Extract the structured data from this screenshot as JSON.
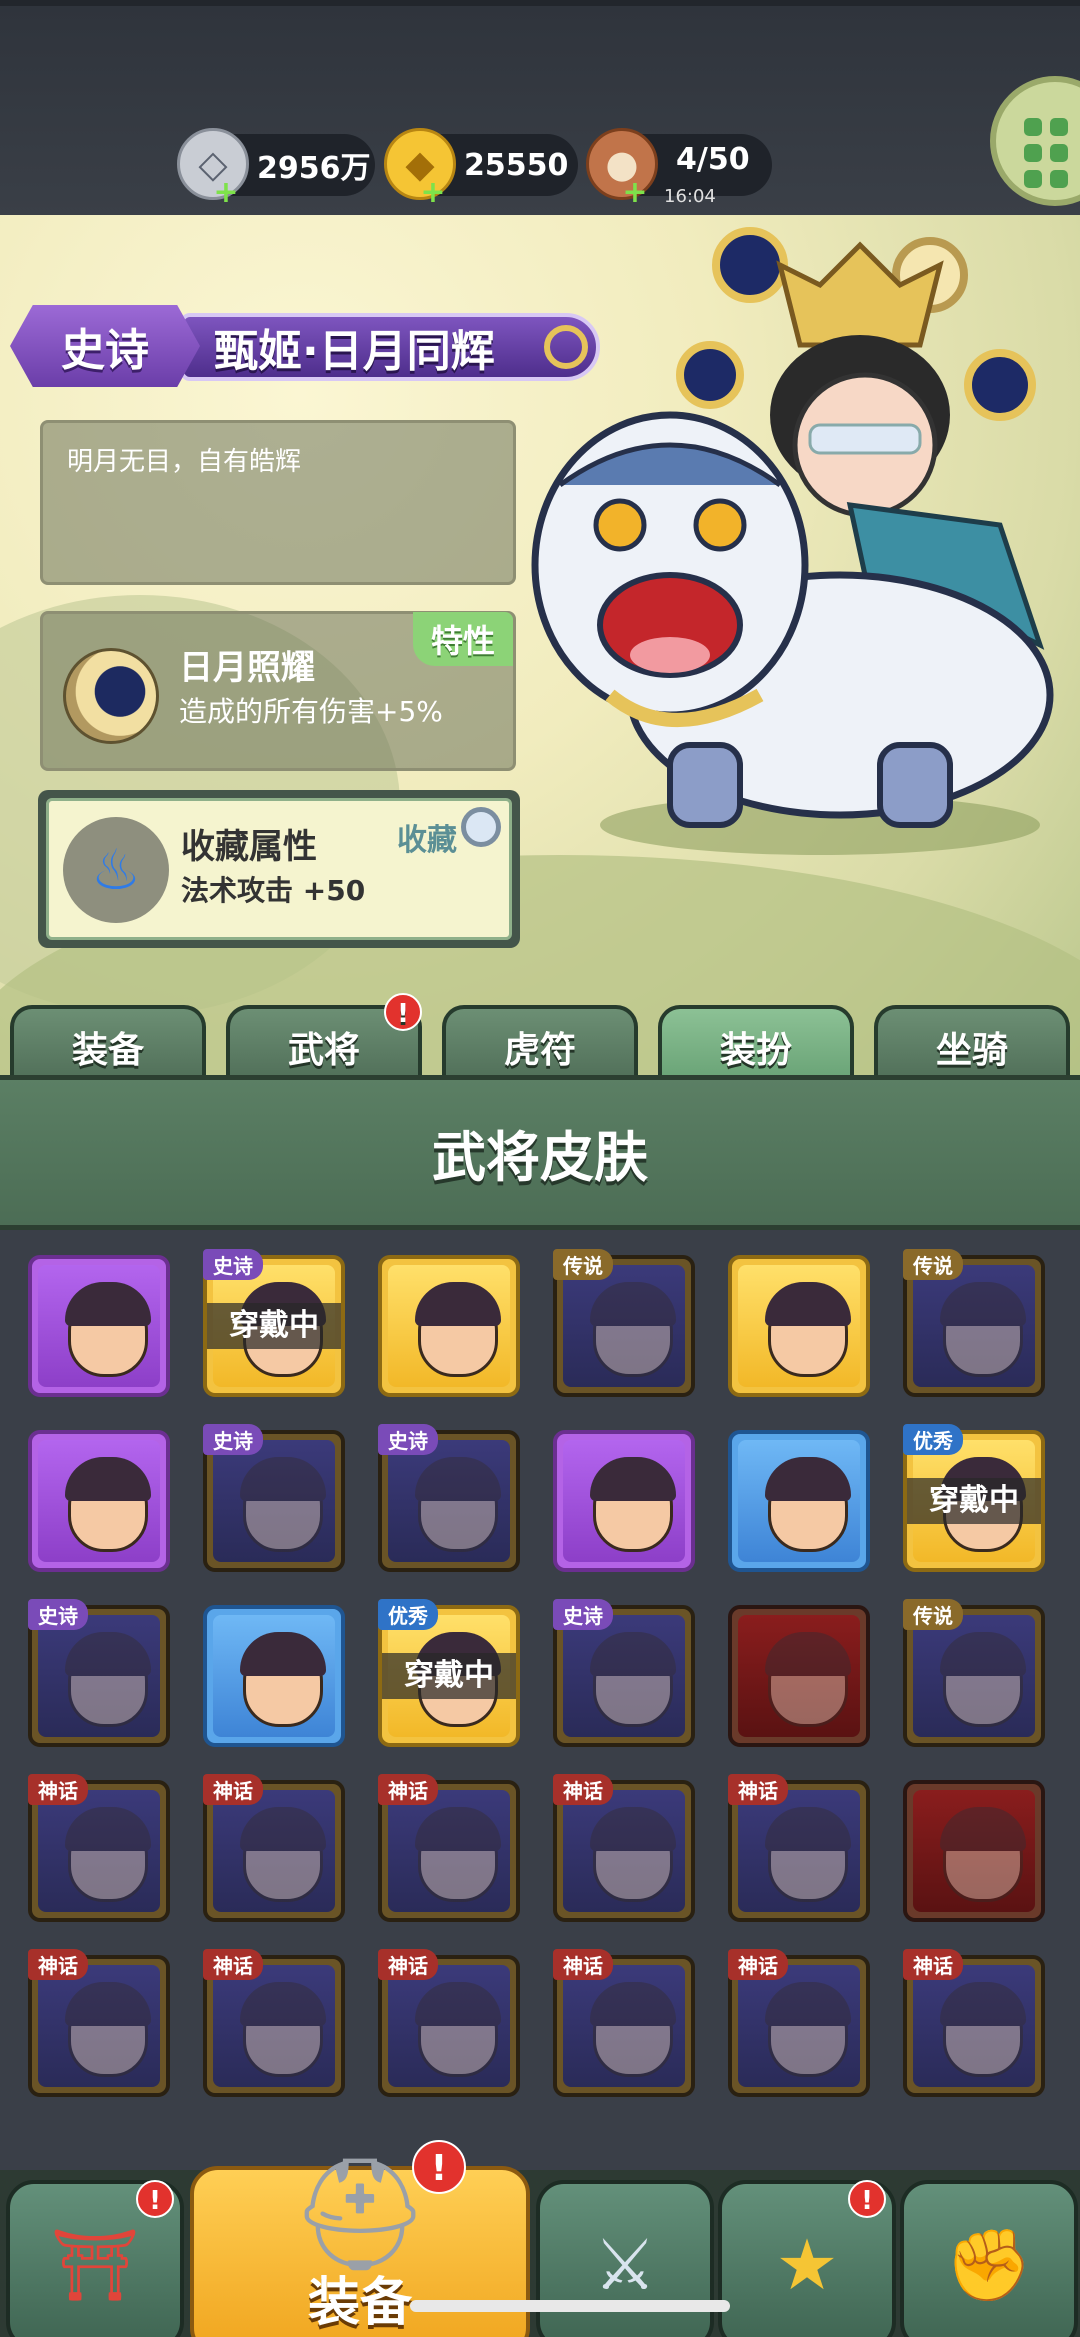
{
  "resources": [
    {
      "icon": "silver-coin-icon",
      "value": "2956万"
    },
    {
      "icon": "gold-ingot-icon",
      "value": "25550"
    },
    {
      "icon": "meat-stamina-icon",
      "value": "4/50",
      "timer": "16:04"
    }
  ],
  "skin": {
    "rarity": "史诗",
    "name": "甄姬·日月同辉",
    "description": "明月无目，自有皓辉",
    "trait": {
      "badge": "特性",
      "name": "日月照耀",
      "effect": "造成的所有伤害+5%"
    },
    "collection": {
      "title": "收藏属性",
      "effect": "法术攻击 +50",
      "tag": "收藏"
    }
  },
  "tabs": [
    {
      "label": "装备",
      "active": false,
      "alert": false
    },
    {
      "label": "武将",
      "active": false,
      "alert": true
    },
    {
      "label": "虎符",
      "active": false,
      "alert": false
    },
    {
      "label": "装扮",
      "active": true,
      "alert": false
    },
    {
      "label": "坐骑",
      "active": false,
      "alert": false
    }
  ],
  "section_title": "武将皮肤",
  "alert_glyph": "!",
  "wearing_label": "穿戴中",
  "skins": [
    {
      "style": "purple",
      "tag": "",
      "wearing": false
    },
    {
      "style": "gold",
      "tag": "史诗",
      "wearing": true
    },
    {
      "style": "gold",
      "tag": "",
      "wearing": false
    },
    {
      "style": "locked",
      "tag": "传说",
      "wearing": false
    },
    {
      "style": "gold",
      "tag": "",
      "wearing": false
    },
    {
      "style": "locked",
      "tag": "传说",
      "wearing": false
    },
    {
      "style": "purple",
      "tag": "",
      "wearing": false
    },
    {
      "style": "locked",
      "tag": "史诗",
      "wearing": false
    },
    {
      "style": "locked",
      "tag": "史诗",
      "wearing": false
    },
    {
      "style": "purple",
      "tag": "",
      "wearing": false
    },
    {
      "style": "blue",
      "tag": "",
      "wearing": false
    },
    {
      "style": "gold",
      "tag": "优秀",
      "wearing": true
    },
    {
      "style": "locked",
      "tag": "史诗",
      "wearing": false
    },
    {
      "style": "blue",
      "tag": "",
      "wearing": false
    },
    {
      "style": "gold",
      "tag": "优秀",
      "wearing": true
    },
    {
      "style": "locked",
      "tag": "史诗",
      "wearing": false
    },
    {
      "style": "red",
      "tag": "",
      "wearing": false
    },
    {
      "style": "locked",
      "tag": "传说",
      "wearing": false
    },
    {
      "style": "locked",
      "tag": "神话",
      "wearing": false
    },
    {
      "style": "locked",
      "tag": "神话",
      "wearing": false
    },
    {
      "style": "locked",
      "tag": "神话",
      "wearing": false
    },
    {
      "style": "locked",
      "tag": "神话",
      "wearing": false
    },
    {
      "style": "locked",
      "tag": "神话",
      "wearing": false
    },
    {
      "style": "red",
      "tag": "",
      "wearing": false
    },
    {
      "style": "locked",
      "tag": "神话",
      "wearing": false
    },
    {
      "style": "locked",
      "tag": "神话",
      "wearing": false
    },
    {
      "style": "locked",
      "tag": "神话",
      "wearing": false
    },
    {
      "style": "locked",
      "tag": "神话",
      "wearing": false
    },
    {
      "style": "locked",
      "tag": "神话",
      "wearing": false
    },
    {
      "style": "locked",
      "tag": "神话",
      "wearing": false
    }
  ],
  "bottom_nav": [
    {
      "icon": "shop-gate-icon",
      "label": "",
      "alert": true
    },
    {
      "icon": "helmet-icon",
      "label": "装备",
      "alert": true
    },
    {
      "icon": "crossed-swords-icon",
      "label": "",
      "alert": false
    },
    {
      "icon": "rank-stars-icon",
      "label": "",
      "alert": true
    },
    {
      "icon": "fist-upgrade-icon",
      "label": "",
      "alert": false
    }
  ]
}
